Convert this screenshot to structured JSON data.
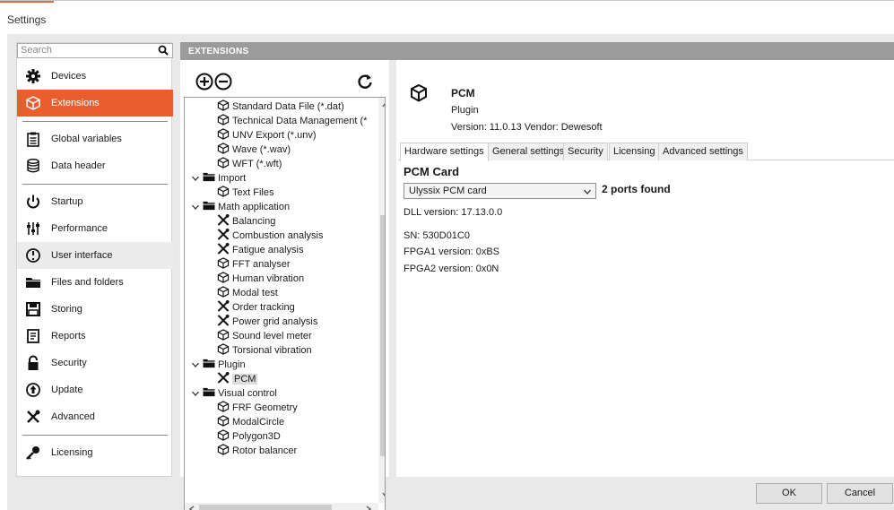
{
  "window": {
    "title": "Settings"
  },
  "sidebar": {
    "search_placeholder": "Search",
    "items": [
      {
        "label": "Devices",
        "icon": "gear-icon"
      },
      {
        "label": "Extensions",
        "icon": "cube-icon"
      },
      {
        "label": "Global variables",
        "icon": "clipboard-icon"
      },
      {
        "label": "Data header",
        "icon": "database-icon"
      },
      {
        "label": "Startup",
        "icon": "power-icon"
      },
      {
        "label": "Performance",
        "icon": "sliders-icon"
      },
      {
        "label": "User interface",
        "icon": "dial-icon"
      },
      {
        "label": "Files and folders",
        "icon": "folder-icon"
      },
      {
        "label": "Storing",
        "icon": "save-icon"
      },
      {
        "label": "Reports",
        "icon": "report-icon"
      },
      {
        "label": "Security",
        "icon": "lock-icon"
      },
      {
        "label": "Update",
        "icon": "update-icon"
      },
      {
        "label": "Advanced",
        "icon": "tools-icon"
      },
      {
        "label": "Licensing",
        "icon": "key-icon"
      }
    ]
  },
  "extensions_header": "EXTENSIONS",
  "tree": {
    "rows": [
      {
        "label": "Standard Data File (*.dat)",
        "icon": "cube-icon"
      },
      {
        "label": "Technical Data Management (*",
        "icon": "cube-icon"
      },
      {
        "label": "UNV Export (*.unv)",
        "icon": "cube-icon"
      },
      {
        "label": "Wave (*.wav)",
        "icon": "cube-icon"
      },
      {
        "label": "WFT (*.wft)",
        "icon": "cube-icon"
      },
      {
        "label": "Import",
        "icon": "folder-icon"
      },
      {
        "label": "Text Files",
        "icon": "cube-icon"
      },
      {
        "label": "Math application",
        "icon": "folder-icon"
      },
      {
        "label": "Balancing",
        "icon": "tools-icon"
      },
      {
        "label": "Combustion analysis",
        "icon": "tools-icon"
      },
      {
        "label": "Fatigue analysis",
        "icon": "tools-icon"
      },
      {
        "label": "FFT analyser",
        "icon": "cube-icon"
      },
      {
        "label": "Human vibration",
        "icon": "cube-icon"
      },
      {
        "label": "Modal test",
        "icon": "cube-icon"
      },
      {
        "label": "Order tracking",
        "icon": "tools-icon"
      },
      {
        "label": "Power grid analysis",
        "icon": "tools-icon"
      },
      {
        "label": "Sound level meter",
        "icon": "cube-icon"
      },
      {
        "label": "Torsional vibration",
        "icon": "cube-icon"
      },
      {
        "label": "Plugin",
        "icon": "folder-icon"
      },
      {
        "label": "PCM",
        "icon": "tools-icon"
      },
      {
        "label": "Visual control",
        "icon": "folder-icon"
      },
      {
        "label": "FRF Geometry",
        "icon": "cube-icon"
      },
      {
        "label": "ModalCircle",
        "icon": "cube-icon"
      },
      {
        "label": "Polygon3D",
        "icon": "cube-icon"
      },
      {
        "label": "Rotor balancer",
        "icon": "cube-icon"
      }
    ]
  },
  "detail": {
    "name": "PCM",
    "type": "Plugin",
    "version_line": "Version: 11.0.13   Vendor: Dewesoft",
    "tabs": [
      "Hardware settings",
      "General settings",
      "Security",
      "Licensing",
      "Advanced settings"
    ],
    "card_title": "PCM Card",
    "card_select": "Ulyssix PCM card",
    "ports": "2 ports found",
    "dll": "DLL version:  17.13.0.0",
    "sn": "SN: 530D01C0",
    "fpga1": "FPGA1 version: 0xBS",
    "fpga2": "FPGA2 version: 0x0N"
  },
  "buttons": {
    "ok": "OK",
    "cancel": "Cancel"
  },
  "colors": {
    "accent": "#ea5e2e",
    "header": "#9b9b9b"
  }
}
